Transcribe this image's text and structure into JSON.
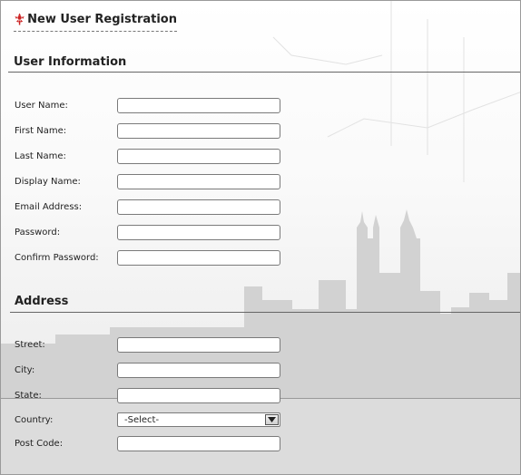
{
  "form": {
    "title": "New User Registration",
    "title_icon": "flower-icon",
    "user_section": {
      "heading": "User Information",
      "fields": [
        {
          "label": "User Name:",
          "value": ""
        },
        {
          "label": "First Name:",
          "value": ""
        },
        {
          "label": "Last Name:",
          "value": ""
        },
        {
          "label": "Display Name:",
          "value": ""
        },
        {
          "label": "Email Address:",
          "value": ""
        },
        {
          "label": "Password:",
          "value": ""
        },
        {
          "label": "Confirm Password:",
          "value": ""
        }
      ]
    },
    "address_section": {
      "heading": "Address",
      "street": {
        "label": "Street:",
        "value": ""
      },
      "city": {
        "label": "City:",
        "value": ""
      },
      "state": {
        "label": "State:",
        "value": ""
      },
      "country": {
        "label": "Country:",
        "selected": "-Select-"
      },
      "post_code": {
        "label": "Post Code:",
        "value": ""
      }
    }
  },
  "colors": {
    "accent_icon": "#cc2222",
    "skyline": "#d4d4d4",
    "rule": "#666666"
  }
}
